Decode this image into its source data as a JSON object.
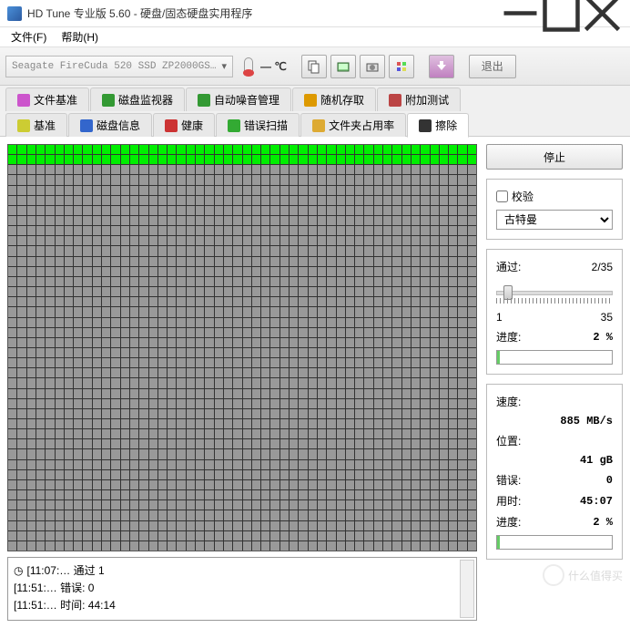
{
  "window": {
    "title": "HD Tune 专业版 5.60 - 硬盘/固态硬盘实用程序"
  },
  "menu": {
    "file": "文件(F)",
    "help": "帮助(H)"
  },
  "toolbar": {
    "drive": "Seagate FireCuda 520 SSD ZP2000GS…",
    "temp": "— ℃",
    "exit": "退出"
  },
  "tabs_row1": [
    {
      "icon": "file-icon",
      "label": "文件基准"
    },
    {
      "icon": "monitor-icon",
      "label": "磁盘监视器"
    },
    {
      "icon": "sound-icon",
      "label": "自动噪音管理"
    },
    {
      "icon": "random-icon",
      "label": "随机存取"
    },
    {
      "icon": "extra-icon",
      "label": "附加测试"
    }
  ],
  "tabs_row2": [
    {
      "icon": "bench-icon",
      "label": "基准"
    },
    {
      "icon": "info-icon",
      "label": "磁盘信息"
    },
    {
      "icon": "health-icon",
      "label": "健康"
    },
    {
      "icon": "scan-icon",
      "label": "错误扫描"
    },
    {
      "icon": "folder-icon",
      "label": "文件夹占用率"
    },
    {
      "icon": "erase-icon",
      "label": "擦除",
      "active": true
    }
  ],
  "action": {
    "stop": "停止"
  },
  "options": {
    "verify_label": "校验",
    "method": "古特曼",
    "pass_label": "通过:",
    "pass_value": "2/35",
    "range_min": "1",
    "range_max": "35",
    "progress_label": "进度:",
    "progress_value": "2 %"
  },
  "stats": {
    "speed_label": "速度:",
    "speed_value": "885 MB/s",
    "pos_label": "位置:",
    "pos_value": "41 gB",
    "err_label": "错误:",
    "err_value": "0",
    "time_label": "用时:",
    "time_value": "45:07",
    "prog_label": "进度:",
    "prog_value": "2 %"
  },
  "log": [
    {
      "icon": "clock-icon",
      "text": "[11:07:…  通过 1"
    },
    {
      "icon": "",
      "text": "[11:51:…  错误: 0"
    },
    {
      "icon": "",
      "text": "[11:51:…  时间: 44:14"
    }
  ],
  "watermark": "什么值得买"
}
